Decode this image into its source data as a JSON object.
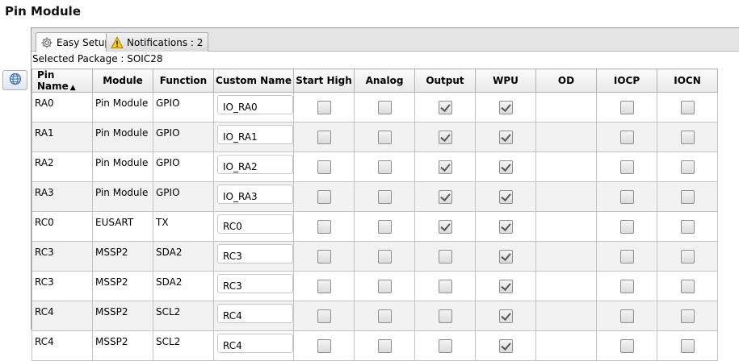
{
  "page": {
    "title": "Pin Module"
  },
  "tabs": [
    {
      "label": "Easy Setup",
      "icon": "gear-icon",
      "active": true
    },
    {
      "label": "Notifications : 2",
      "icon": "warning-icon",
      "active": false
    }
  ],
  "package_label": "Selected Package : SOIC28",
  "columns": {
    "pin_name": "Pin Name",
    "module": "Module",
    "function": "Function",
    "custom_name": "Custom Name",
    "start_high": "Start High",
    "analog": "Analog",
    "output": "Output",
    "wpu": "WPU",
    "od": "OD",
    "iocp": "IOCP",
    "iocn": "IOCN"
  },
  "rows": [
    {
      "pin": "RA0",
      "module": "Pin Module",
      "function": "GPIO",
      "custom_name": "IO_RA0",
      "start_high": false,
      "analog": false,
      "output": true,
      "wpu": true,
      "iocp": false,
      "iocn": false
    },
    {
      "pin": "RA1",
      "module": "Pin Module",
      "function": "GPIO",
      "custom_name": "IO_RA1",
      "start_high": false,
      "analog": false,
      "output": true,
      "wpu": true,
      "iocp": false,
      "iocn": false
    },
    {
      "pin": "RA2",
      "module": "Pin Module",
      "function": "GPIO",
      "custom_name": "IO_RA2",
      "start_high": false,
      "analog": false,
      "output": true,
      "wpu": true,
      "iocp": false,
      "iocn": false
    },
    {
      "pin": "RA3",
      "module": "Pin Module",
      "function": "GPIO",
      "custom_name": "IO_RA3",
      "start_high": false,
      "analog": false,
      "output": true,
      "wpu": true,
      "iocp": false,
      "iocn": false
    },
    {
      "pin": "RC0",
      "module": "EUSART",
      "function": "TX",
      "custom_name": "RC0",
      "start_high": false,
      "analog": false,
      "output": true,
      "wpu": true,
      "iocp": false,
      "iocn": false
    },
    {
      "pin": "RC3",
      "module": "MSSP2",
      "function": "SDA2",
      "custom_name": "RC3",
      "start_high": false,
      "analog": false,
      "output": false,
      "wpu": true,
      "iocp": false,
      "iocn": false
    },
    {
      "pin": "RC3",
      "module": "MSSP2",
      "function": "SDA2",
      "custom_name": "RC3",
      "start_high": false,
      "analog": false,
      "output": false,
      "wpu": true,
      "iocp": false,
      "iocn": false
    },
    {
      "pin": "RC4",
      "module": "MSSP2",
      "function": "SCL2",
      "custom_name": "RC4",
      "start_high": false,
      "analog": false,
      "output": false,
      "wpu": true,
      "iocp": false,
      "iocn": false
    },
    {
      "pin": "RC4",
      "module": "MSSP2",
      "function": "SCL2",
      "custom_name": "RC4",
      "start_high": false,
      "analog": false,
      "output": false,
      "wpu": true,
      "iocp": false,
      "iocn": false
    }
  ]
}
